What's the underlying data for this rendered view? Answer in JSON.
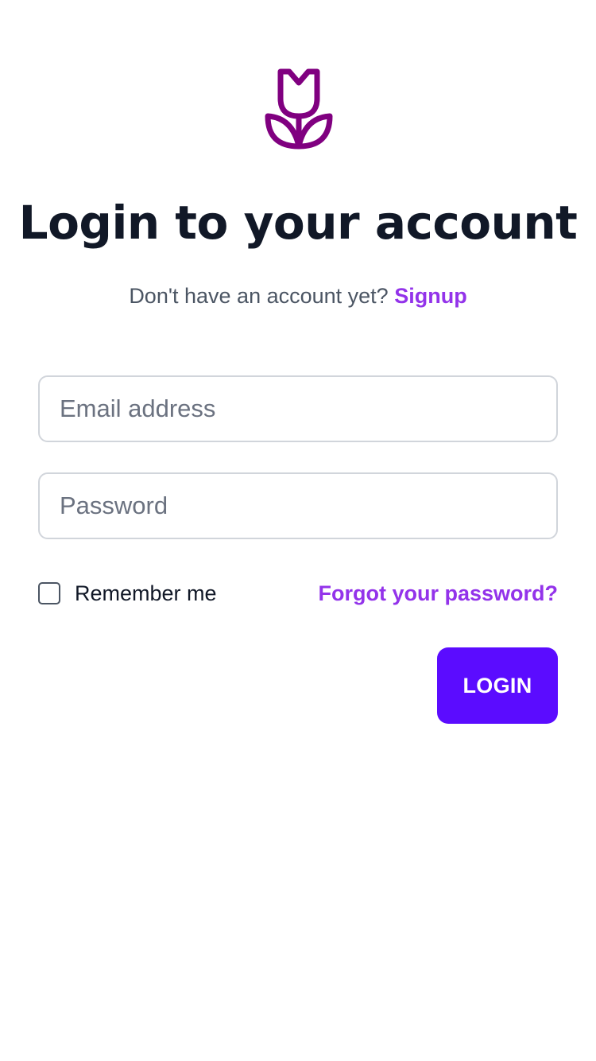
{
  "colors": {
    "logo": "#800080",
    "title": "#111827",
    "subtitle": "#4b5563",
    "link": "#9333ea",
    "input_border": "#d1d5db",
    "placeholder": "#6b7280",
    "button": "#5b0cff",
    "button_text": "#ffffff"
  },
  "logo": {
    "icon": "tulip-icon"
  },
  "header": {
    "title": "Login to your account",
    "prompt": "Don't have an account yet?",
    "signup_label": "Signup"
  },
  "form": {
    "email": {
      "placeholder": "Email address",
      "value": ""
    },
    "password": {
      "placeholder": "Password",
      "value": ""
    },
    "remember_label": "Remember me",
    "remember_checked": false,
    "forgot_label": "Forgot your password?",
    "submit_label": "LOGIN"
  }
}
